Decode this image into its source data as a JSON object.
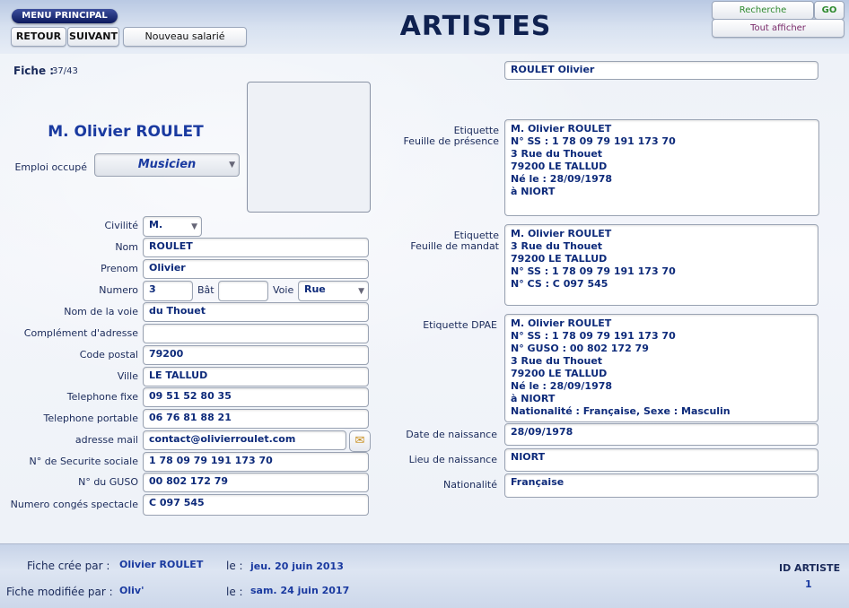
{
  "header": {
    "menu_principal": "MENU PRINCIPAL",
    "retour": "RETOUR",
    "suivant": "SUIVANT",
    "nouveau": "Nouveau salarié",
    "title": "ARTISTES",
    "recherche": "Recherche",
    "go": "GO",
    "tout_afficher": "Tout afficher"
  },
  "fiche": {
    "label": "Fiche :",
    "value": "37/43",
    "full_name_field": "ROULET Olivier",
    "display_name": "M. Olivier ROULET"
  },
  "emploi": {
    "label": "Emploi occupé",
    "value": "Musicien"
  },
  "form": {
    "civilite": {
      "label": "Civilité",
      "value": "M."
    },
    "nom": {
      "label": "Nom",
      "value": "ROULET"
    },
    "prenom": {
      "label": "Prenom",
      "value": "Olivier"
    },
    "numero": {
      "label": "Numero",
      "value": "3"
    },
    "bat": {
      "label": "Bât",
      "value": ""
    },
    "voie": {
      "label": "Voie",
      "value": "Rue"
    },
    "nom_voie": {
      "label": "Nom de la voie",
      "value": "du Thouet"
    },
    "complement": {
      "label": "Complément d'adresse",
      "value": ""
    },
    "code_postal": {
      "label": "Code postal",
      "value": "79200"
    },
    "ville": {
      "label": "Ville",
      "value": "LE TALLUD"
    },
    "tel_fixe": {
      "label": "Telephone fixe",
      "value": "09 51 52 80 35"
    },
    "tel_portable": {
      "label": "Telephone portable",
      "value": "06 76 81 88 21"
    },
    "email": {
      "label": "adresse mail",
      "value": "contact@olivierroulet.com"
    },
    "secu": {
      "label": "N° de Securite sociale",
      "value": "1 78 09 79 191 173 70"
    },
    "guso": {
      "label": "N° du GUSO",
      "value": "00 802 172 79"
    },
    "conges": {
      "label": "Numero congés spectacle",
      "value": "C 097 545"
    }
  },
  "right": {
    "etiquette_presence": {
      "label_1": "Etiquette",
      "label_2": "Feuille de présence",
      "lines": [
        "M. Olivier ROULET",
        "N° SS : 1 78 09 79 191 173 70",
        "3 Rue du Thouet",
        "79200 LE TALLUD",
        "Né le : 28/09/1978",
        "à NIORT"
      ]
    },
    "etiquette_mandat": {
      "label_1": "Etiquette",
      "label_2": "Feuille de mandat",
      "lines": [
        "M. Olivier ROULET",
        "3 Rue du Thouet",
        "79200 LE TALLUD",
        "N° SS : 1 78 09 79 191 173 70",
        "N° CS : C 097 545"
      ]
    },
    "etiquette_dpae": {
      "label": "Etiquette DPAE",
      "lines": [
        "M. Olivier ROULET",
        "N° SS : 1 78 09 79 191 173 70",
        "N° GUSO : 00 802 172 79",
        "3 Rue du Thouet",
        "79200 LE TALLUD",
        "Né le : 28/09/1978",
        "à NIORT",
        "Nationalité : Française, Sexe : Masculin"
      ]
    },
    "date_naissance": {
      "label": "Date de naissance",
      "value": "28/09/1978"
    },
    "lieu_naissance": {
      "label": "Lieu de naissance",
      "value": "NIORT"
    },
    "nationalite": {
      "label": "Nationalité",
      "value": "Française"
    }
  },
  "footer": {
    "cree_label": "Fiche crée par :",
    "cree_par": "Olivier ROULET",
    "le_label": "le :",
    "cree_date": "jeu. 20 juin 2013",
    "modifiee_label": "Fiche modifiée par :",
    "modifiee_par": "Oliv'",
    "modifiee_date": "sam. 24 juin 2017",
    "id_label": "ID ARTISTE",
    "id_value": "1"
  },
  "colors": {
    "accent": "#1a3aa0",
    "menu_bg": "#0c1a5e",
    "go_green": "#2f8a2f",
    "tout_afficher": "#7a2a6a"
  }
}
